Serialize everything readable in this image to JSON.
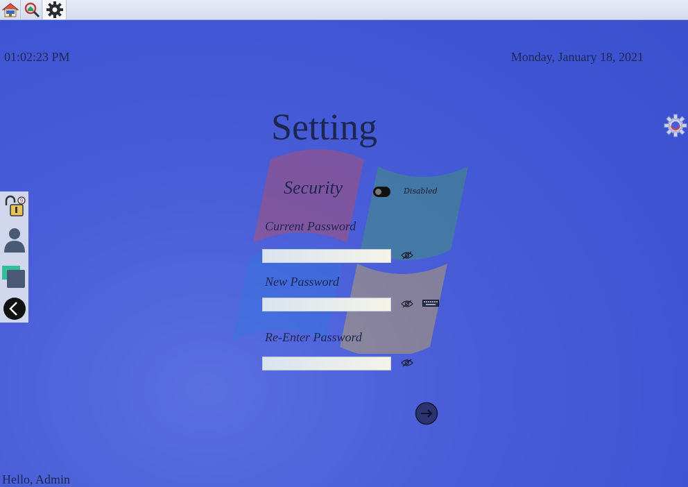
{
  "toolbar": {
    "items": [
      {
        "name": "home",
        "icon": "home-icon"
      },
      {
        "name": "search",
        "icon": "search-icon"
      },
      {
        "name": "settings",
        "icon": "gear-icon",
        "active": true
      }
    ]
  },
  "header": {
    "time": "01:02:23 PM",
    "date": "Monday, January 18, 2021"
  },
  "page": {
    "title": "Setting"
  },
  "security": {
    "label": "Security",
    "toggle_state": "Disabled",
    "toggle_on": false
  },
  "form": {
    "current_password_label": "Current Password",
    "current_password_value": "",
    "new_password_label": "New Password",
    "new_password_value": "",
    "reenter_password_label": "Re-Enter Password",
    "reenter_password_value": ""
  },
  "sidebar": {
    "items": [
      {
        "icon": "lock-icon"
      },
      {
        "icon": "user-icon"
      },
      {
        "icon": "windows-icon"
      },
      {
        "icon": "back-icon"
      }
    ]
  },
  "footer": {
    "greeting": "Hello, Admin"
  },
  "colors": {
    "background": "#4358d6",
    "text": "#1c2650",
    "sidebar": "#dce2ee"
  }
}
